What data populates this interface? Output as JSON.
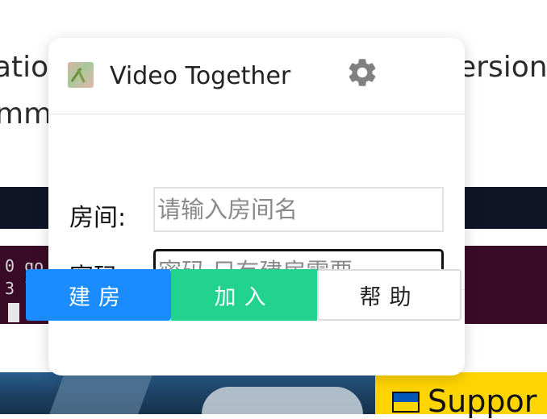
{
  "background": {
    "line1_left": "ation",
    "line2_left": "mm",
    "line1_right": "ersion",
    "terminal_lines": [
      "0 go ",
      "3 li"
    ],
    "support_text": "Suppor"
  },
  "popup": {
    "title": "Video Together",
    "settings_icon": "gear-icon",
    "room_label": "房间:",
    "room_placeholder": "请输入房间名",
    "password_label": "密码:",
    "password_placeholder": "密码,只有建房需要",
    "buttons": {
      "create": "建房",
      "join": "加入",
      "help": "帮助"
    }
  },
  "colors": {
    "create": "#1a8cff",
    "join": "#22d38f",
    "help_border": "#dcdcdc"
  }
}
